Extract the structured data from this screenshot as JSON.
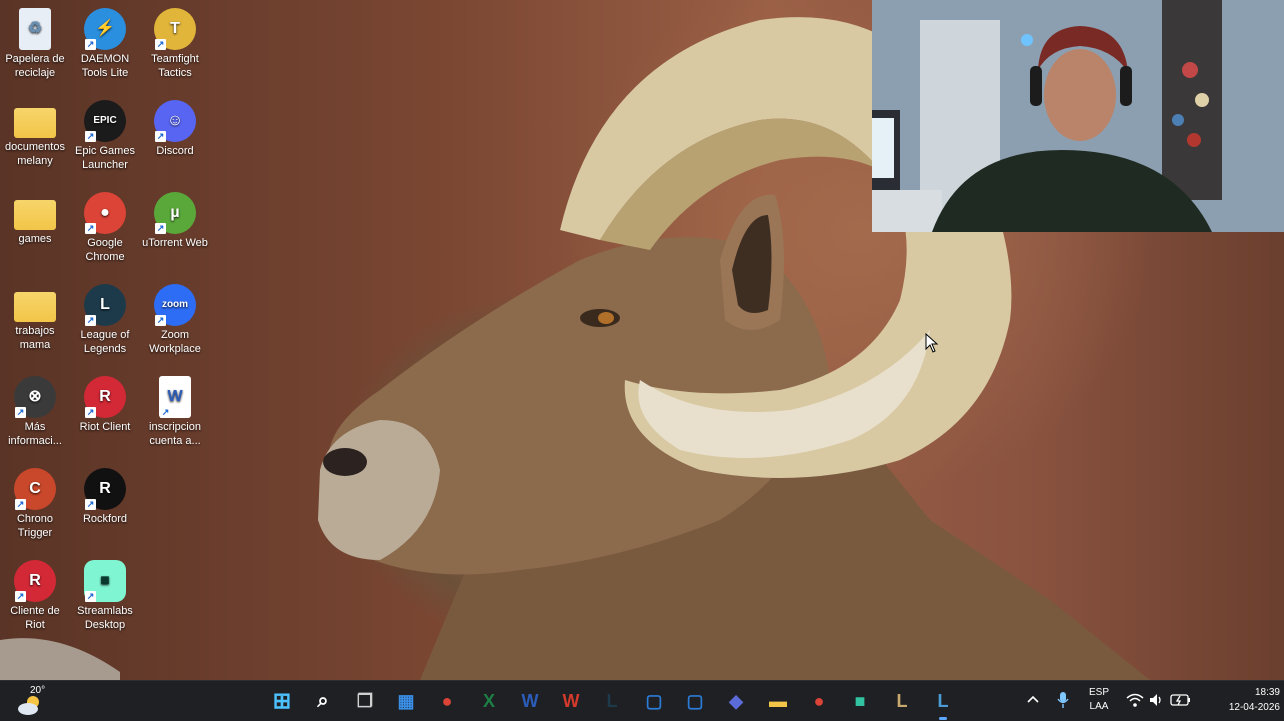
{
  "desktop": {
    "icons": [
      {
        "label": "Papelera de reciclaje",
        "icon": "recycle-bin-icon",
        "color": "#e8eef5"
      },
      {
        "label": "DAEMON Tools Lite",
        "icon": "daemon-tools-icon",
        "color": "#2b8fe0"
      },
      {
        "label": "Teamfight Tactics",
        "icon": "teamfight-tactics-icon",
        "color": "#e0b53a"
      },
      {
        "label": "documentos melany",
        "icon": "folder-icon",
        "color": "#f2c548"
      },
      {
        "label": "Epic Games Launcher",
        "icon": "epic-games-icon",
        "color": "#1b1b1b"
      },
      {
        "label": "Discord",
        "icon": "discord-icon",
        "color": "#5865f2"
      },
      {
        "label": "games",
        "icon": "folder-icon",
        "color": "#f2c548"
      },
      {
        "label": "Google Chrome",
        "icon": "chrome-icon",
        "color": "#db4437"
      },
      {
        "label": "uTorrent Web",
        "icon": "utorrent-icon",
        "color": "#5aa83a"
      },
      {
        "label": "trabajos mama",
        "icon": "folder-icon",
        "color": "#f2c548"
      },
      {
        "label": "League of Legends",
        "icon": "league-of-legends-icon",
        "color": "#1d3a4a"
      },
      {
        "label": "Zoom Workplace",
        "icon": "zoom-icon",
        "color": "#2d6df6"
      },
      {
        "label": "Más informaci...",
        "icon": "info-circle-icon",
        "color": "#3a3a3a"
      },
      {
        "label": "Riot Client",
        "icon": "riot-client-icon",
        "color": "#d32936"
      },
      {
        "label": "inscripcion cuenta a...",
        "icon": "word-document-icon",
        "color": "#ffffff"
      },
      {
        "label": "Chrono Trigger",
        "icon": "chrono-trigger-icon",
        "color": "#c9472a"
      },
      {
        "label": "Rockford",
        "icon": "rockford-icon",
        "color": "#111111"
      },
      {
        "label": "Cliente de Riot",
        "icon": "riot-client-icon",
        "color": "#d32936"
      },
      {
        "label": "Streamlabs Desktop",
        "icon": "streamlabs-icon",
        "color": "#80f5d2"
      }
    ]
  },
  "taskbar": {
    "weather": {
      "temp": "20°",
      "icon": "weather-cloud-sun-icon"
    },
    "apps": [
      {
        "name": "start-button",
        "icon": "windows-start-icon",
        "color": "#4cc2ff"
      },
      {
        "name": "search-button",
        "icon": "search-icon",
        "color": "#ffffff"
      },
      {
        "name": "task-view-button",
        "icon": "task-view-icon",
        "color": "#d0d0d0"
      },
      {
        "name": "microsoft-store",
        "icon": "store-icon",
        "color": "#3a8ee6"
      },
      {
        "name": "google-chrome",
        "icon": "chrome-icon",
        "color": "#db4437"
      },
      {
        "name": "excel",
        "icon": "excel-icon",
        "color": "#1d7f45"
      },
      {
        "name": "word",
        "icon": "word-icon",
        "color": "#2b5cb8"
      },
      {
        "name": "wps-office",
        "icon": "wps-icon",
        "color": "#d33a2c"
      },
      {
        "name": "league-of-legends",
        "icon": "league-of-legends-icon",
        "color": "#1d3a4a"
      },
      {
        "name": "app-window-1",
        "icon": "window-icon",
        "color": "#2c7bd6"
      },
      {
        "name": "app-window-2",
        "icon": "window-icon",
        "color": "#2c7bd6"
      },
      {
        "name": "visual-studio",
        "icon": "diamond-icon",
        "color": "#5b6bd8"
      },
      {
        "name": "file-explorer",
        "icon": "folder-icon",
        "color": "#f2c548"
      },
      {
        "name": "google-chrome-2",
        "icon": "chrome-icon",
        "color": "#db4437"
      },
      {
        "name": "streamlabs",
        "icon": "streamlabs-icon",
        "color": "#31c3a2"
      },
      {
        "name": "league-client",
        "icon": "league-of-legends-icon",
        "color": "#c8aa6e"
      },
      {
        "name": "league-client-active",
        "icon": "league-of-legends-icon",
        "color": "#4a9bd6"
      }
    ],
    "tray": {
      "language": "ESP",
      "layout": "LAA",
      "time": "18:39",
      "date": "12-04-2026"
    }
  },
  "colors": {
    "taskbar_bg": "#1f2023",
    "accent": "#5fa8ff"
  }
}
